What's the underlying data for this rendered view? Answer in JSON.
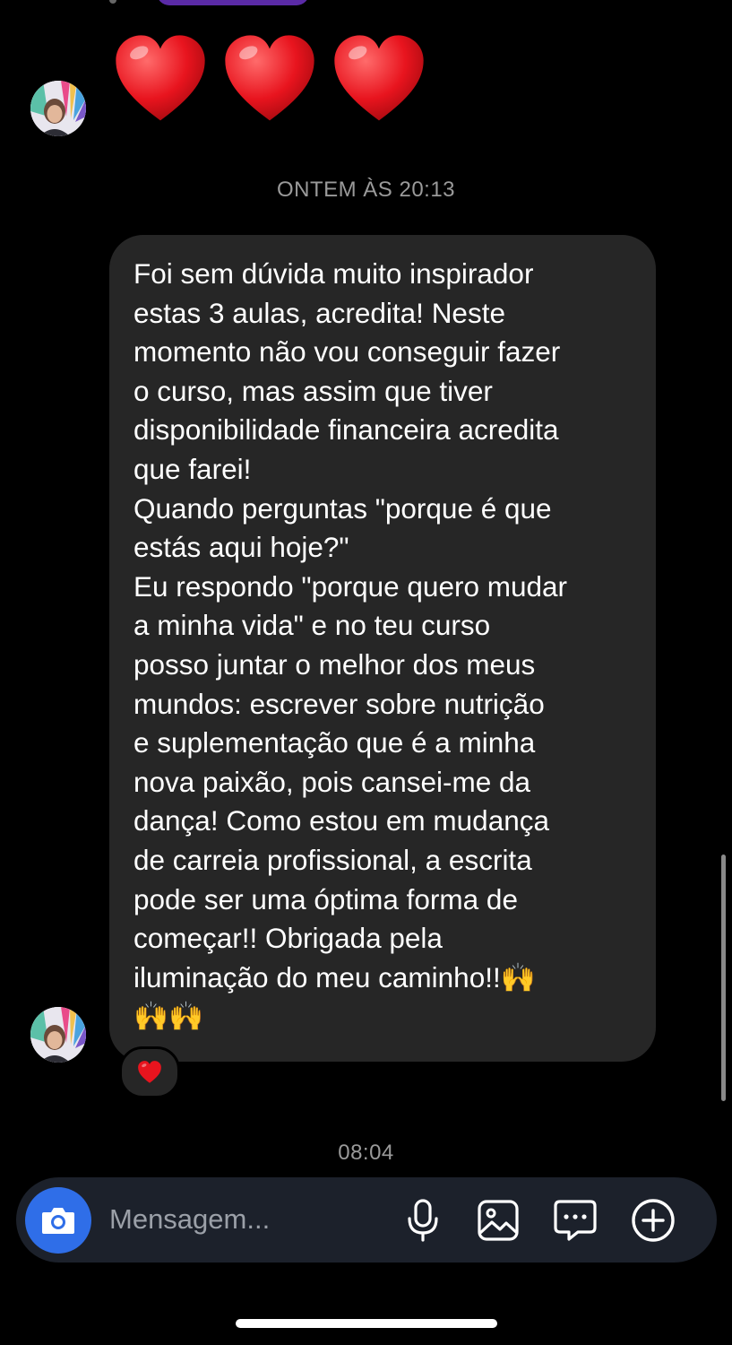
{
  "conversation": {
    "timestamp_1": "ONTEM ÀS 20:13",
    "timestamp_2": "08:04",
    "reaction_emoji": "red-heart",
    "received_message": {
      "lines": [
        "Foi sem dúvida muito inspirador",
        "estas 3 aulas, acredita! Neste",
        "momento não vou conseguir fazer",
        "o curso, mas assim que tiver",
        "disponibilidade financeira acredita",
        "que farei!",
        "Quando perguntas \"porque é que",
        "estás aqui hoje?\"",
        "Eu respondo \"porque quero mudar",
        "a minha vida\" e no teu curso",
        "posso juntar o melhor dos meus",
        "mundos: escrever sobre nutrição",
        "e suplementação que é a minha",
        "nova paixão, pois cansei-me da",
        "dança! Como estou em mudança",
        "de carreia profissional, a escrita",
        "pode ser uma óptima forma de",
        "começar!! Obrigada pela",
        "iluminação do meu caminho!!🙌",
        "🙌🙌"
      ]
    },
    "hearts_message": {
      "count": 3,
      "emoji": "red-heart"
    }
  },
  "composer": {
    "placeholder": "Mensagem...",
    "icons": [
      "camera-icon",
      "microphone-icon",
      "gallery-icon",
      "sticker-chat-icon",
      "plus-icon"
    ],
    "accent_color": "#2f6ee8"
  },
  "colors": {
    "background": "#000000",
    "bubble": "#262626",
    "timestamp": "#9a9a9a"
  }
}
